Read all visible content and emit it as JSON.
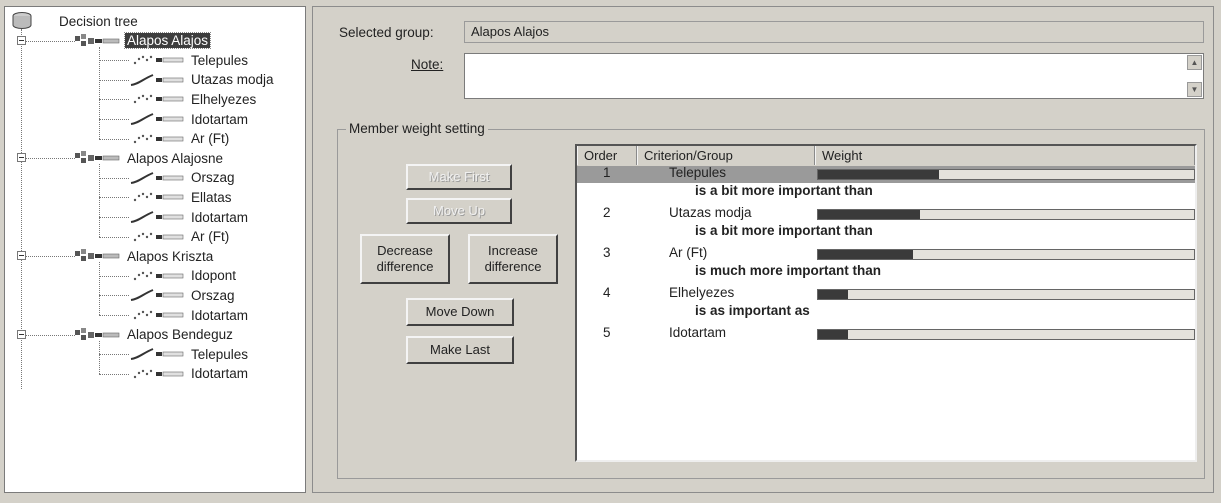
{
  "tree": {
    "root_label": "Decision tree",
    "groups": [
      {
        "label": "Alapos Alajos",
        "selected": true,
        "children": [
          "Telepules",
          "Utazas modja",
          "Elhelyezes",
          "Idotartam",
          "Ar (Ft)"
        ]
      },
      {
        "label": "Alapos Alajosne",
        "selected": false,
        "children": [
          "Orszag",
          "Ellatas",
          "Idotartam",
          "Ar (Ft)"
        ]
      },
      {
        "label": "Alapos Kriszta",
        "selected": false,
        "children": [
          "Idopont",
          "Orszag",
          "Idotartam"
        ]
      },
      {
        "label": "Alapos Bendeguz",
        "selected": false,
        "children": [
          "Telepules",
          "Idotartam"
        ]
      }
    ]
  },
  "form": {
    "selected_group_label": "Selected group:",
    "selected_group_value": "Alapos Alajos",
    "note_label": "Note:",
    "note_value": ""
  },
  "weights": {
    "group_title": "Member weight setting",
    "buttons": {
      "make_first": "Make First",
      "move_up": "Move Up",
      "decrease_1": "Decrease",
      "decrease_2": "difference",
      "increase_1": "Increase",
      "increase_2": "difference",
      "move_down": "Move Down",
      "make_last": "Make Last"
    },
    "columns": [
      "Order",
      "Criterion/Group",
      "Weight"
    ],
    "rows": [
      {
        "order": "1",
        "name": "Telepules",
        "weight": 0.32
      },
      {
        "order": "2",
        "name": "Utazas modja",
        "weight": 0.27
      },
      {
        "order": "3",
        "name": "Ar (Ft)",
        "weight": 0.25
      },
      {
        "order": "4",
        "name": "Elhelyezes",
        "weight": 0.08
      },
      {
        "order": "5",
        "name": "Idotartam",
        "weight": 0.08
      }
    ],
    "relations": [
      "is a bit more important than",
      "is a bit more important than",
      "is much more important than",
      "is as important as"
    ]
  },
  "colors": {
    "bar_fill": "#3a3a3a",
    "bar_bg": "#e4e2dc",
    "selection": "#3d3d3d"
  }
}
